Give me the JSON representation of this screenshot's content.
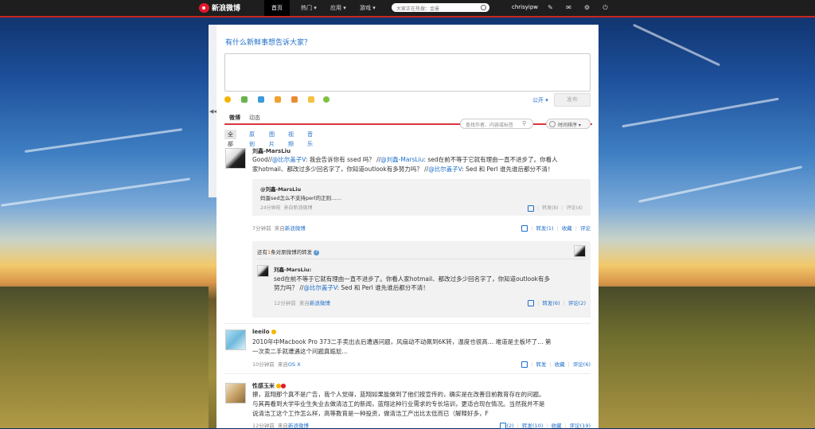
{
  "topbar": {
    "logo": "新浪微博",
    "nav": [
      "首页",
      "热门 ▾",
      "应用 ▾",
      "游戏 ▾"
    ],
    "search_placeholder": "大家正在热搜：金曼",
    "username": "chrisyipw",
    "icons": [
      "edit-icon",
      "mail-icon",
      "settings-icon",
      "power-icon"
    ]
  },
  "compose": {
    "title": "有什么新鲜事想告诉大家？",
    "toolbar_icons": [
      "emoji-icon",
      "image-icon",
      "video-icon",
      "topic-icon",
      "vote-icon",
      "app-icon",
      "more-icon"
    ],
    "visibility": "公开 ▾",
    "post_label": "发布"
  },
  "tabs": {
    "main": [
      "微博",
      "动态"
    ],
    "filter_placeholder": "查找作者、内容或标签",
    "sort_label": "时间排序 ▾",
    "sub": [
      "全部",
      "原创",
      "图片",
      "视频",
      "音乐"
    ]
  },
  "feed": [
    {
      "author": "刘鑫-MarsLiu",
      "text_line1": "Good//",
      "text_line1_link": "@比尔盖子V",
      "text_line1_rest": ": 我会告诉你有 ssed 吗？ //",
      "text_line1_link2": "@刘鑫-MarsLiu",
      "text_line1_rest2": ": sed在前不等于它就有理由一直不进步了。你看人",
      "text_line2": "家hotmail、都改过多少回名字了，你知道outlook有多努力吗？ //",
      "text_line2_link": "@比尔盖子V",
      "text_line2_rest": ": Sed 和 Perl 谁先谁后都分不清！",
      "quote": {
        "author": "@刘鑫-MarsLiu",
        "text": "妈蛋sed怎么不支持perl的正则……",
        "time": "24分钟前",
        "source_prefix": "来自",
        "source": "新浪微博",
        "actions": [
          "转发(8)",
          "评论(4)"
        ]
      },
      "time": "7分钟前",
      "source_prefix": "来自",
      "source": "新浪微博",
      "actions": [
        "转发(1)",
        "收藏",
        "评论"
      ]
    }
  ],
  "more_reposts": {
    "prefix": "还有",
    "count": "1",
    "suffix": "条对原微博的转发"
  },
  "repost": {
    "author": "刘鑫-MarsLiu",
    "colon": ":",
    "text_line1": "sed在前不等于它就有理由一直不进步了。你看人家hotmail、都改过多少回名字了，你知道outlook有多",
    "text_line2_prefix": "努力吗？ //",
    "text_line2_link": "@比尔盖子V",
    "text_line2_rest": ": Sed 和 Perl 谁先谁后都分不清！",
    "time": "12分钟前",
    "source_prefix": "来自",
    "source": "新浪微博",
    "actions": [
      "转发(6)",
      "评论(2)"
    ]
  },
  "post2": {
    "author": "leeilo",
    "text_line1": "2010年中Macbook Pro 373二手卖出去后遭遇问题，风扇动不动飙到6K转，温度也很高… 难道是主板坏了… 第",
    "text_line2": "一次卖二手就遭遇这个问题真尴尬…",
    "time": "10分钟前",
    "source_prefix": "来自",
    "source": "OS X",
    "actions": [
      "转发",
      "收藏",
      "评论(6)"
    ]
  },
  "post3": {
    "author": "性感玉米",
    "text_line1": "擦，蓝翔那个真不是广告，我个人觉得，蓝翔如果能做到了他们按宣传的，确实是在改善目前教育存在的问题。",
    "text_line2": "与其再看到大学毕业生失业去做清洁工的新闻，蓝翔这种行业需求的专长培训，更适合现在情况。当然我并不是",
    "text_line3": "说清洁工这个工作怎么样，高等教育是一种投资，做清洁工产出比太低而已（解释好多，F",
    "time": "12分钟前",
    "source_prefix": "来自",
    "source": "新浪微博",
    "actions": [
      "(2)",
      "转发(10)",
      "收藏",
      "评论(19)"
    ]
  }
}
